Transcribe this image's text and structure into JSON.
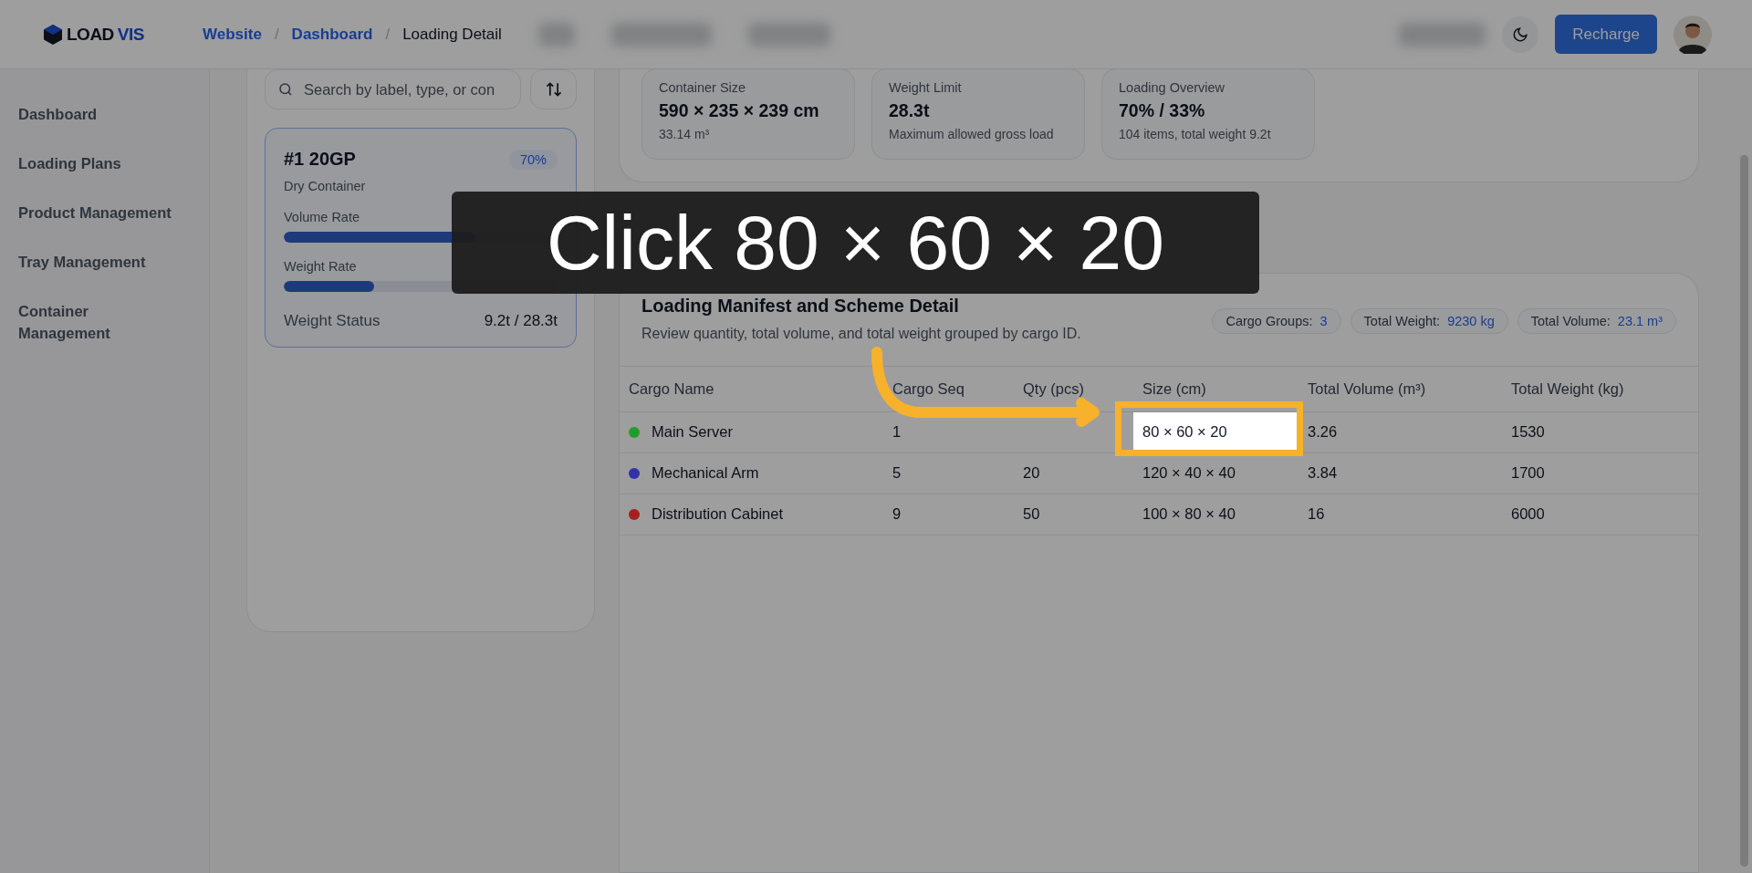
{
  "header": {
    "logo": [
      "LOAD",
      "VIS"
    ],
    "separator": "/",
    "breadcrumb": [
      {
        "label": "Website",
        "link": true
      },
      {
        "label": "Dashboard",
        "link": true
      },
      {
        "label": "Loading Detail",
        "link": false
      }
    ],
    "button": "Recharge"
  },
  "sidebar": {
    "items": [
      {
        "label": "Dashboard"
      },
      {
        "label": "Loading Plans"
      },
      {
        "label": "Product Management"
      },
      {
        "label": "Tray Management"
      },
      {
        "label": "Container Management"
      }
    ]
  },
  "container_list": {
    "search": {
      "placeholder": "Search by label, type, or con"
    },
    "cards": [
      {
        "title": "#1 20GP",
        "badge": "70%",
        "type": "Dry Container",
        "selected": true,
        "metrics": [
          {
            "label": "Volume Rate",
            "level": 0.7
          },
          {
            "label": "Weight Rate",
            "level": 0.33
          }
        ],
        "status_label": "Weight Status",
        "status_value": "9.2t / 28.3t"
      }
    ]
  },
  "summary": {
    "stats": [
      {
        "label": "Container Size",
        "value": "590 × 235 × 239 cm",
        "note": "33.14 m³"
      },
      {
        "label": "Weight Limit",
        "value": "28.3t",
        "note": "Maximum allowed gross load"
      },
      {
        "label": "Loading Overview",
        "value": "70% / 33%",
        "note": "104 items, total weight 9.2t"
      }
    ]
  },
  "manifest": {
    "title": "Loading Manifest and Scheme Detail",
    "subtitle": "Review quantity, total volume, and total weight grouped by cargo ID.",
    "chips": [
      {
        "label": "Cargo Groups:",
        "value": "3"
      },
      {
        "label": "Total Weight:",
        "value": "9230 kg"
      },
      {
        "label": "Total Volume:",
        "value": "23.1 m³"
      }
    ],
    "columns": [
      "Cargo Name",
      "Cargo Seq",
      "Qty (pcs)",
      "Size (cm)",
      "Total Volume (m³)",
      "Total Weight (kg)"
    ],
    "rows": [
      {
        "name": "Main Server",
        "color": "#1f9d2b",
        "seq": "1",
        "size": "80 × 60 × 20",
        "volume": "3.26",
        "weight": "1530",
        "highlighted": true
      },
      {
        "name": "Mechanical Arm",
        "color": "#3232a8",
        "seq": "5",
        "qty": "20",
        "size": "120 × 40 × 40",
        "volume": "3.84",
        "weight": "1700",
        "highlighted": false
      },
      {
        "name": "Distribution Cabinet",
        "color": "#a61e1e",
        "seq": "9",
        "qty": "50",
        "size": "100 × 80 × 40",
        "volume": "16",
        "weight": "6000",
        "highlighted": false
      }
    ]
  },
  "tutorial": {
    "caption": "Click 80 × 60 × 20"
  }
}
